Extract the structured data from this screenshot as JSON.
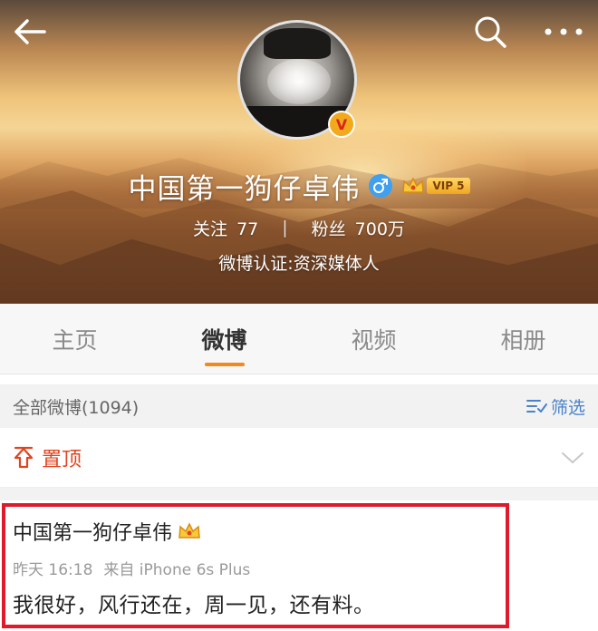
{
  "profile": {
    "name": "中国第一狗仔卓伟",
    "vip_label": "VIP 5",
    "verified_badge": "V",
    "following_label": "关注",
    "following_count": "77",
    "followers_label": "粉丝",
    "followers_count": "700万",
    "verification": "微博认证:资深媒体人"
  },
  "tabs": [
    {
      "label": "主页",
      "active": false
    },
    {
      "label": "微博",
      "active": true
    },
    {
      "label": "视频",
      "active": false
    },
    {
      "label": "相册",
      "active": false
    }
  ],
  "filter": {
    "title": "全部微博(1094)",
    "button_label": "筛选"
  },
  "pinned": {
    "label": "置顶"
  },
  "post": {
    "author": "中国第一狗仔卓伟",
    "time": "昨天 16:18",
    "source": "来自 iPhone 6s Plus",
    "text": "我很好，风行还在，周一见，还有料。"
  },
  "colors": {
    "accent_orange": "#f08a1e",
    "pinned_red": "#e0441f",
    "filter_blue": "#4a82c9",
    "highlight_frame": "#e0192b"
  },
  "icons": {
    "back": "back-arrow-icon",
    "search": "search-icon",
    "more": "more-dots-icon",
    "gender": "male-icon",
    "crown": "crown-icon",
    "filter": "filter-icon",
    "pin": "pin-up-icon",
    "expand": "chevron-down-icon"
  }
}
